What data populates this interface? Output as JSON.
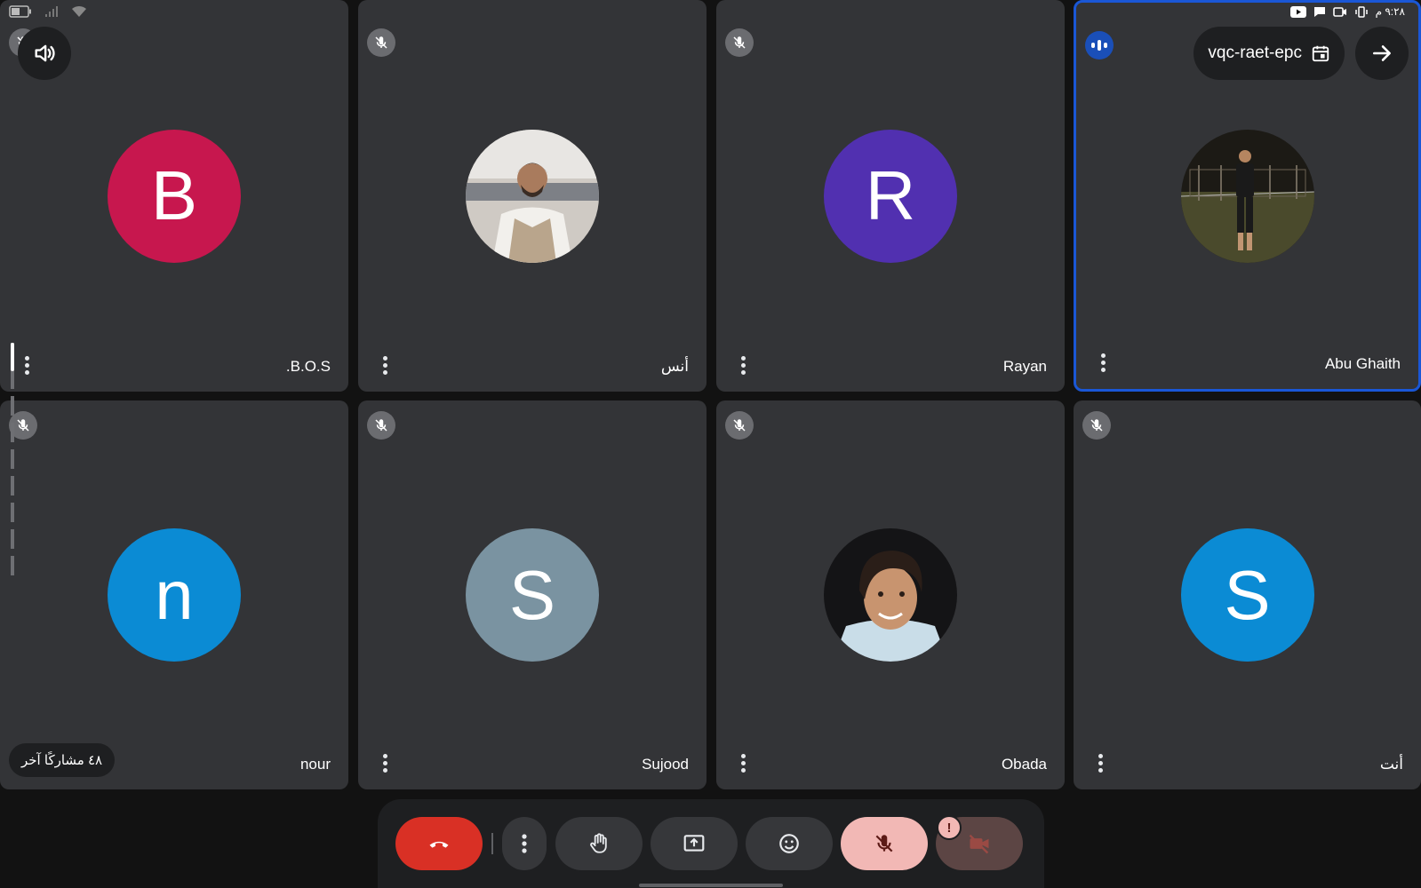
{
  "status_bar": {
    "time": "٩:٢٨ م"
  },
  "meeting": {
    "code": "vqc-raet-epc"
  },
  "participants": [
    {
      "name": ".B.O.S",
      "initial": "B",
      "color": "#c7174e"
    },
    {
      "name": "أنس",
      "initial": "",
      "color": ""
    },
    {
      "name": "Rayan",
      "initial": "R",
      "color": "#5130b0"
    },
    {
      "name": "Abu Ghaith",
      "initial": "",
      "color": ""
    },
    {
      "name": "nour",
      "initial": "n",
      "color": "#0b8bd4"
    },
    {
      "name": "Sujood",
      "initial": "S",
      "color": "#7a93a1"
    },
    {
      "name": "Obada",
      "initial": "",
      "color": ""
    },
    {
      "name": "أنت",
      "initial": "S",
      "color": "#0b8bd4"
    }
  ],
  "others_label": "٤٨ مشاركًا آخر",
  "icons": {
    "volume": "volume-icon",
    "calendar": "calendar-icon",
    "arrow": "arrow-right-icon",
    "mic_off": "mic-off-icon",
    "speaking": "speaking-indicator-icon",
    "more": "more-vert-icon",
    "end_call": "end-call-icon",
    "raise_hand": "raise-hand-icon",
    "present": "present-screen-icon",
    "reactions": "emoji-icon",
    "camera_off": "camera-off-icon",
    "alert": "alert-icon"
  },
  "colors": {
    "tile_bg": "#333437",
    "active_border": "#1a57d6",
    "end_call": "#d93025",
    "mic_muted": "#f2b8b5",
    "camera_off": "#5c4544"
  }
}
